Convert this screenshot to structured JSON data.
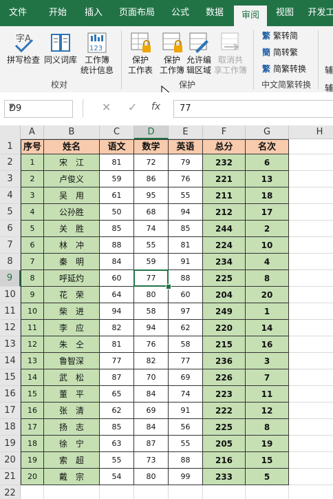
{
  "tabs": [
    "文件",
    "开始",
    "插入",
    "页面布局",
    "公式",
    "数据",
    "审阅",
    "视图",
    "开发工"
  ],
  "active_tab": "审阅",
  "ribbon": {
    "proofing": {
      "spell_check": "拼写检查",
      "thesaurus": "同义词库",
      "stats_line1": "工作簿",
      "stats_line2": "统计信息",
      "group_label": "校对"
    },
    "protect": {
      "protect_sheet_line1": "保护",
      "protect_sheet_line2": "工作表",
      "protect_wb_line1": "保护",
      "protect_wb_line2": "工作簿",
      "allow_edit_line1": "允许编",
      "allow_edit_line2": "辑区域",
      "unshare_line1": "取消共",
      "unshare_line2": "享工作簿",
      "group_label": "保护"
    },
    "chinese": {
      "to_simplified": "繁转简",
      "to_traditional": "简转繁",
      "convert": "简繁转换",
      "group_label": "中文简繁转换"
    },
    "overflow_label": "辅"
  },
  "formula_bar": {
    "name_box": "D9",
    "cancel": "✕",
    "enter": "✓",
    "fx": "fx",
    "value": "77"
  },
  "columns": [
    "A",
    "B",
    "C",
    "D",
    "E",
    "F",
    "G",
    "H"
  ],
  "selected_column": "D",
  "selected_row": 9,
  "row_numbers": [
    1,
    2,
    3,
    4,
    5,
    6,
    7,
    8,
    9,
    10,
    11,
    12,
    13,
    14,
    15,
    16,
    17,
    18,
    19,
    20,
    21,
    22
  ],
  "headers": [
    "序号",
    "姓名",
    "语文",
    "数学",
    "英语",
    "总分",
    "名次"
  ],
  "rows": [
    [
      "1",
      "宋　江",
      "81",
      "72",
      "79",
      "232",
      "6"
    ],
    [
      "2",
      "卢俊义",
      "59",
      "86",
      "76",
      "221",
      "13"
    ],
    [
      "3",
      "吴　用",
      "61",
      "95",
      "55",
      "211",
      "18"
    ],
    [
      "4",
      "公孙胜",
      "50",
      "68",
      "94",
      "212",
      "17"
    ],
    [
      "5",
      "关　胜",
      "85",
      "74",
      "85",
      "244",
      "2"
    ],
    [
      "6",
      "林　冲",
      "88",
      "55",
      "81",
      "224",
      "10"
    ],
    [
      "7",
      "秦　明",
      "84",
      "59",
      "91",
      "234",
      "4"
    ],
    [
      "8",
      "呼延灼",
      "60",
      "77",
      "88",
      "225",
      "8"
    ],
    [
      "9",
      "花　荣",
      "64",
      "80",
      "60",
      "204",
      "20"
    ],
    [
      "10",
      "柴　进",
      "94",
      "58",
      "97",
      "249",
      "1"
    ],
    [
      "11",
      "李　应",
      "82",
      "94",
      "62",
      "220",
      "14"
    ],
    [
      "12",
      "朱　仝",
      "81",
      "76",
      "58",
      "215",
      "16"
    ],
    [
      "13",
      "鲁智深",
      "77",
      "82",
      "77",
      "236",
      "3"
    ],
    [
      "14",
      "武　松",
      "87",
      "70",
      "69",
      "226",
      "7"
    ],
    [
      "15",
      "董　平",
      "65",
      "84",
      "74",
      "223",
      "11"
    ],
    [
      "16",
      "张　清",
      "62",
      "69",
      "91",
      "222",
      "12"
    ],
    [
      "17",
      "扬　志",
      "85",
      "84",
      "56",
      "225",
      "8"
    ],
    [
      "18",
      "徐　宁",
      "63",
      "87",
      "55",
      "205",
      "19"
    ],
    [
      "19",
      "索　超",
      "55",
      "73",
      "88",
      "216",
      "15"
    ],
    [
      "20",
      "戴　宗",
      "54",
      "80",
      "99",
      "233",
      "5"
    ]
  ],
  "colors": {
    "accent": "#217346",
    "header_fill": "#f8cbad",
    "green_fill": "#c6e0b4"
  }
}
